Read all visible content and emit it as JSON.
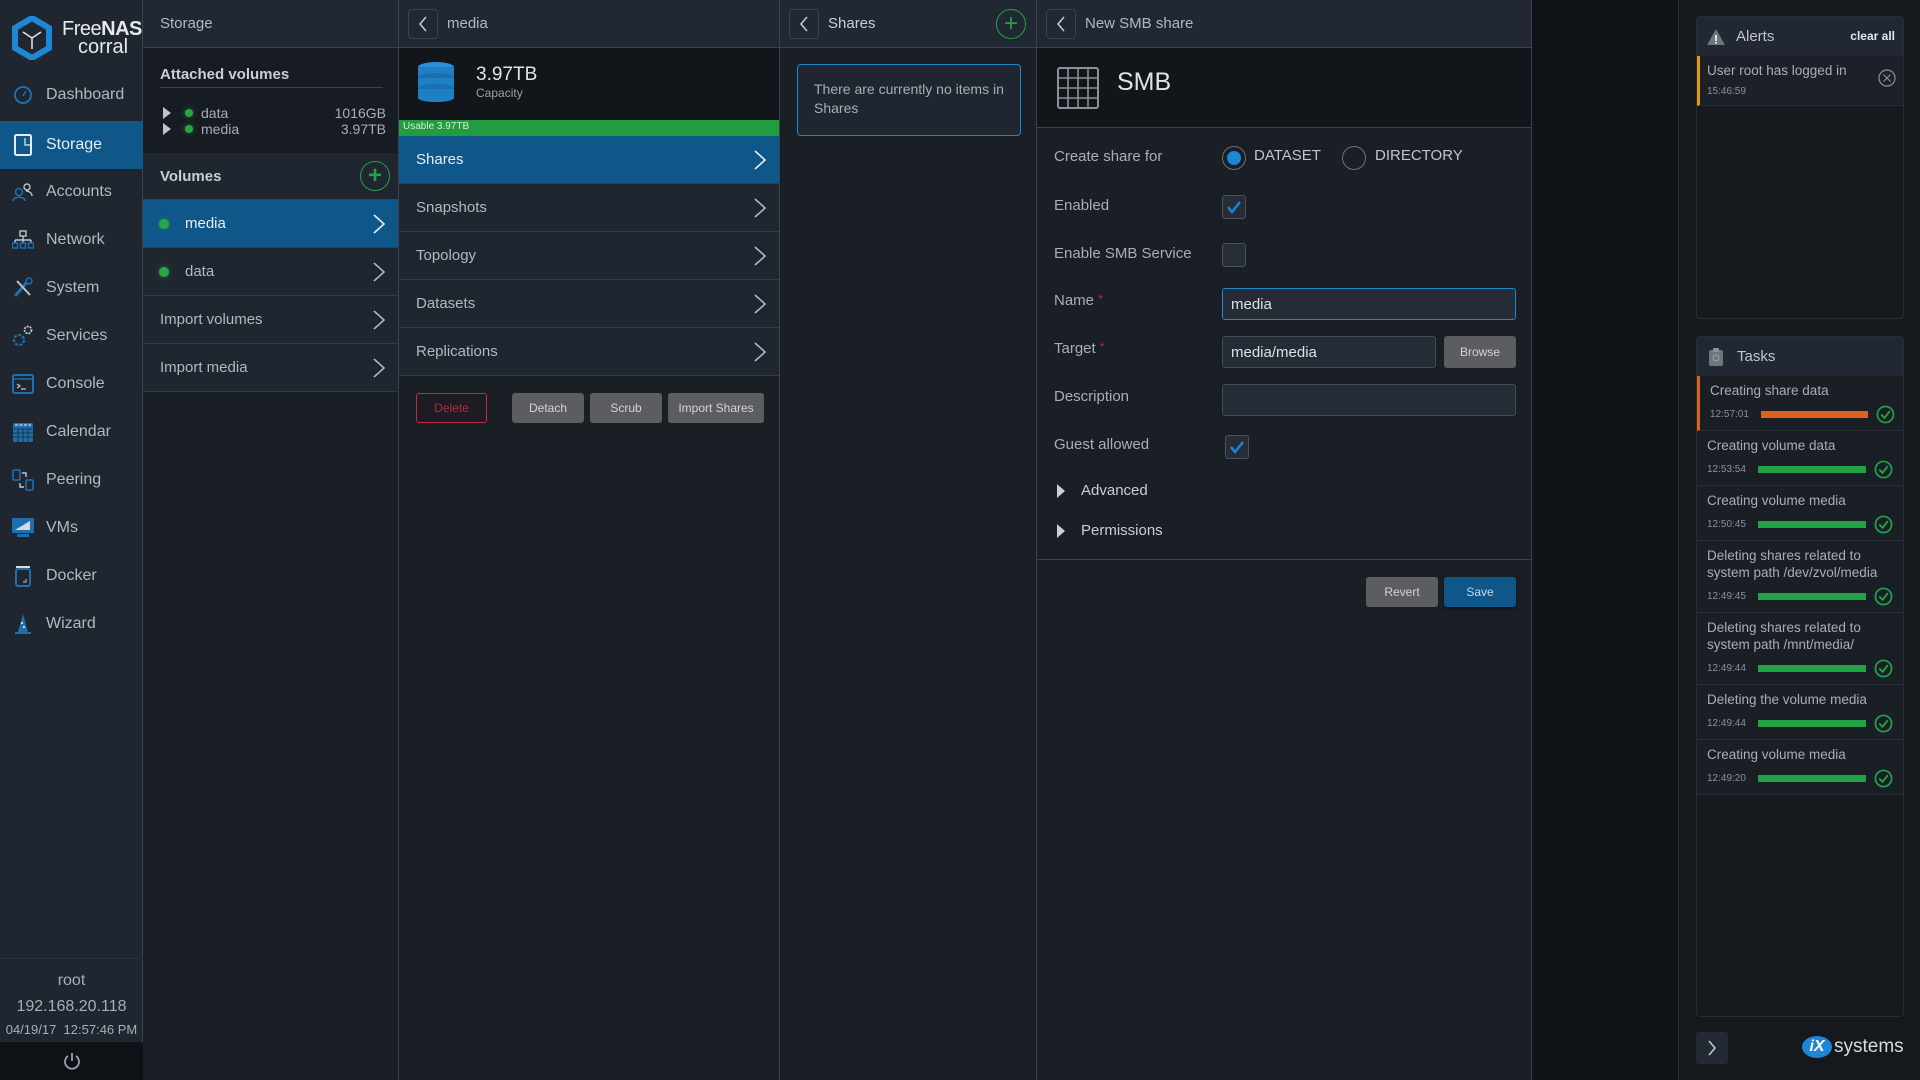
{
  "brand": {
    "name_light": "Free",
    "name_bold": "NAS",
    "sub": "corral"
  },
  "sidebar": {
    "items": [
      {
        "label": "Dashboard",
        "icon": "dashboard-icon",
        "active": false
      },
      {
        "label": "Storage",
        "icon": "storage-icon",
        "active": true
      },
      {
        "label": "Accounts",
        "icon": "accounts-icon",
        "active": false
      },
      {
        "label": "Network",
        "icon": "network-icon",
        "active": false
      },
      {
        "label": "System",
        "icon": "system-icon",
        "active": false
      },
      {
        "label": "Services",
        "icon": "services-icon",
        "active": false
      },
      {
        "label": "Console",
        "icon": "console-icon",
        "active": false
      },
      {
        "label": "Calendar",
        "icon": "calendar-icon",
        "active": false
      },
      {
        "label": "Peering",
        "icon": "peering-icon",
        "active": false
      },
      {
        "label": "VMs",
        "icon": "vms-icon",
        "active": false
      },
      {
        "label": "Docker",
        "icon": "docker-icon",
        "active": false
      },
      {
        "label": "Wizard",
        "icon": "wizard-icon",
        "active": false
      }
    ],
    "user": "root",
    "ip": "192.168.20.118",
    "datetime": "04/19/17  12:57:46 PM",
    "power_icon": "power-icon"
  },
  "storage": {
    "title": "Storage",
    "attached_title": "Attached volumes",
    "attached": [
      {
        "name": "data",
        "size": "1016GB"
      },
      {
        "name": "media",
        "size": "3.97TB"
      }
    ],
    "volumes_title": "Volumes",
    "volumes": [
      {
        "name": "media",
        "active": true
      },
      {
        "name": "data",
        "active": false
      }
    ],
    "import_volumes": "Import volumes",
    "import_media": "Import media"
  },
  "media": {
    "title": "media",
    "capacity_value": "3.97TB",
    "capacity_label": "Capacity",
    "usable_label": "Usable 3.97TB",
    "usable_fraction": 1.0,
    "menu": [
      {
        "label": "Shares",
        "active": true
      },
      {
        "label": "Snapshots",
        "active": false
      },
      {
        "label": "Topology",
        "active": false
      },
      {
        "label": "Datasets",
        "active": false
      },
      {
        "label": "Replications",
        "active": false
      }
    ],
    "buttons": {
      "delete": "Delete",
      "detach": "Detach",
      "scrub": "Scrub",
      "import_shares": "Import Shares"
    }
  },
  "shares": {
    "title": "Shares",
    "empty_message": "There are currently no items in Shares"
  },
  "smb": {
    "header": "New SMB share",
    "title": "SMB",
    "create_share_for_label": "Create share for",
    "radio_options": [
      {
        "label": "DATASET",
        "selected": true
      },
      {
        "label": "DIRECTORY",
        "selected": false
      }
    ],
    "enabled_label": "Enabled",
    "enabled": true,
    "enable_service_label": "Enable SMB Service",
    "enable_service": false,
    "name_label": "Name",
    "name_value": "media",
    "target_label": "Target",
    "target_value": "media/media",
    "browse_label": "Browse",
    "description_label": "Description",
    "description_value": "",
    "guest_label": "Guest allowed",
    "guest": true,
    "required_mark": "*",
    "advanced_label": "Advanced",
    "permissions_label": "Permissions",
    "revert_label": "Revert",
    "save_label": "Save"
  },
  "alerts": {
    "title": "Alerts",
    "clear_all": "clear all",
    "items": [
      {
        "message": "User root has logged in",
        "time": "15:46:59"
      }
    ]
  },
  "tasks": {
    "title": "Tasks",
    "items": [
      {
        "title": "Creating share data",
        "time": "12:57:01",
        "progress": 1.0,
        "color": "#e06020",
        "active": true
      },
      {
        "title": "Creating volume data",
        "time": "12:53:54",
        "progress": 1.0,
        "color": "#22a245",
        "active": false
      },
      {
        "title": "Creating volume media",
        "time": "12:50:45",
        "progress": 1.0,
        "color": "#22a245",
        "active": false
      },
      {
        "title": "Deleting shares related to system path /dev/zvol/media",
        "time": "12:49:45",
        "progress": 1.0,
        "color": "#22a245",
        "active": false
      },
      {
        "title": "Deleting shares related to system path /mnt/media/",
        "time": "12:49:44",
        "progress": 1.0,
        "color": "#22a245",
        "active": false
      },
      {
        "title": "Deleting the volume media",
        "time": "12:49:44",
        "progress": 1.0,
        "color": "#22a245",
        "active": false
      },
      {
        "title": "Creating volume media",
        "time": "12:49:20",
        "progress": 1.0,
        "color": "#22a245",
        "active": false
      }
    ]
  },
  "footer": {
    "vendor": "systems",
    "vendor_prefix": "iX"
  },
  "colors": {
    "accent": "#0f5689",
    "success": "#22a245",
    "warning": "#e09a12",
    "danger": "#c02d45",
    "task_active": "#e06020",
    "focus": "#1e86d0"
  }
}
